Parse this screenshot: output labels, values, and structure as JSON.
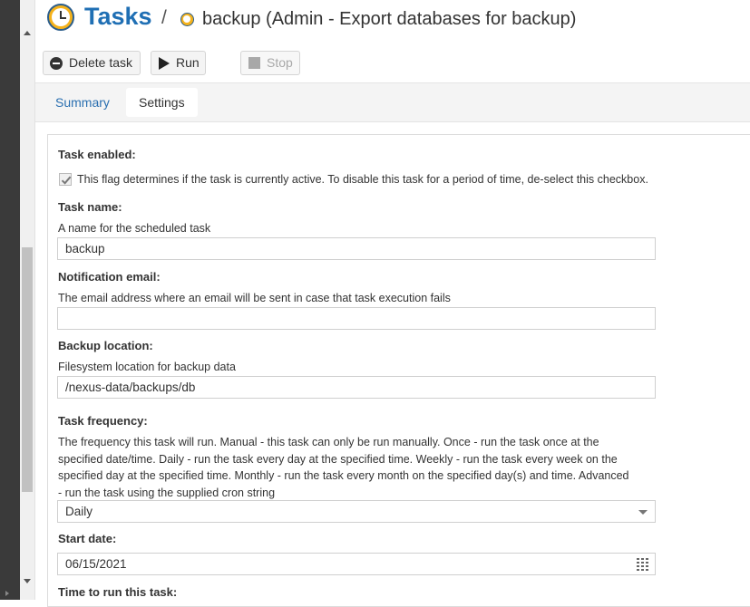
{
  "header": {
    "title": "Tasks",
    "separator": "/",
    "subtitle": "backup (Admin - Export databases for backup)",
    "title_icon": "clock-icon",
    "subtitle_icon": "clock-icon"
  },
  "toolbar": {
    "delete_label": "Delete task",
    "run_label": "Run",
    "stop_label": "Stop"
  },
  "tabs": [
    {
      "label": "Summary",
      "active": false
    },
    {
      "label": "Settings",
      "active": true
    }
  ],
  "form": {
    "task_enabled": {
      "label": "Task enabled:",
      "description": "This flag determines if the task is currently active. To disable this task for a period of time, de-select this checkbox.",
      "checked": true
    },
    "task_name": {
      "label": "Task name:",
      "description": "A name for the scheduled task",
      "value": "backup"
    },
    "notification_email": {
      "label": "Notification email:",
      "description": "The email address where an email will be sent in case that task execution fails",
      "value": ""
    },
    "backup_location": {
      "label": "Backup location:",
      "description": "Filesystem location for backup data",
      "value": "/nexus-data/backups/db"
    },
    "task_frequency": {
      "label": "Task frequency:",
      "description_lines": [
        "The frequency this task will run. Manual - this task can only be run manually. Once - run the task once at the",
        "specified date/time. Daily - run the task every day at the specified time. Weekly - run the task every week on the",
        "specified day at the specified time. Monthly - run the task every month on the specified day(s) and time. Advanced",
        "- run the task using the supplied cron string"
      ],
      "value": "Daily"
    },
    "start_date": {
      "label": "Start date:",
      "value": "06/15/2021"
    },
    "time_to_run": {
      "label": "Time to run this task:"
    }
  },
  "colors": {
    "accent": "#1f6fb4",
    "link": "#2a6fb0",
    "text": "#333333"
  }
}
